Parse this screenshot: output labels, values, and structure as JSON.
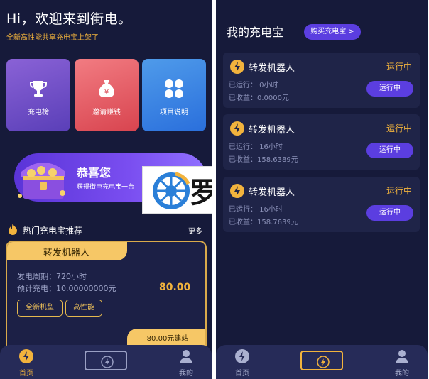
{
  "home": {
    "greeting": "Hi，欢迎来到街电。",
    "subtitle": "全新高性能共享充电宝上架了",
    "tiles": [
      {
        "label": "充电榜",
        "icon": "trophy-icon",
        "color": "#7a52cf"
      },
      {
        "label": "邀请赚钱",
        "icon": "money-bag-icon",
        "color": "#e2545c"
      },
      {
        "label": "项目说明",
        "icon": "grid-icon",
        "color": "#3c86e6"
      }
    ],
    "banner": {
      "title": "恭喜您",
      "text": "获得街电充电宝一台"
    },
    "logo": {
      "text": "罗网",
      "registered": "®"
    },
    "hot_section": {
      "title": "热门充电宝推荐",
      "more": "更多"
    },
    "product": {
      "name": "转发机器人",
      "period": "发电周期：720小时",
      "charge": "预计充电：10.00000000元",
      "price": "80.00",
      "tags": [
        "全新机型",
        "高性能"
      ],
      "footer": "80.00元建站"
    }
  },
  "my_power": {
    "title": "我的充电宝",
    "buy_button": "购买充电宝 >",
    "robots": [
      {
        "name": "转发机器人",
        "status": "运行中",
        "runtime": "已运行：  0小时",
        "earnings": "已收益：0.0000元",
        "button": "运行中"
      },
      {
        "name": "转发机器人",
        "status": "运行中",
        "runtime": "已运行：  16小时",
        "earnings": "已收益：158.6389元",
        "button": "运行中"
      },
      {
        "name": "转发机器人",
        "status": "运行中",
        "runtime": "已运行：  16小时",
        "earnings": "已收益：158.7639元",
        "button": "运行中"
      }
    ]
  },
  "tabbar": {
    "home": "首页",
    "mine": "我的",
    "active_color": "#f2b33d",
    "inactive_color": "#aab0d0"
  }
}
